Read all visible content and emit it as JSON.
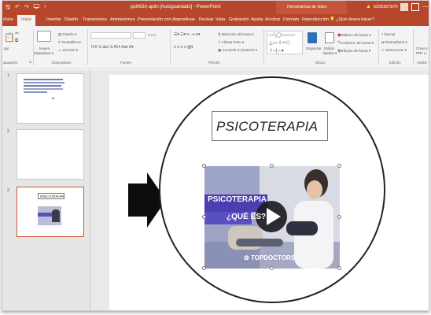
{
  "titlebar": {
    "quick_access": "🖫 ↶ ↷ 🖵 ▾",
    "window_title": "pptNOA aptin [Autoguardado] - PowerPoint",
    "context_label": "Herramientas de vídeo",
    "user": "5256367870",
    "minimize": "—"
  },
  "tabs": [
    {
      "label": "chivo"
    },
    {
      "label": "Inicio",
      "active": true
    },
    {
      "label": "Insertar"
    },
    {
      "label": "Diseño"
    },
    {
      "label": "Transiciones"
    },
    {
      "label": "Animaciones"
    },
    {
      "label": "Presentación con diapositivas"
    },
    {
      "label": "Revisar"
    },
    {
      "label": "Vista"
    },
    {
      "label": "Grabación"
    },
    {
      "label": "Ayuda"
    },
    {
      "label": "Acrobat"
    },
    {
      "label": "Formato"
    },
    {
      "label": "Reproducción"
    },
    {
      "label": "¿Qué desea hacer?"
    }
  ],
  "ribbon": {
    "clipboard": {
      "label": "apapeles",
      "paste": "gar"
    },
    "slides": {
      "label": "Diapositivas",
      "new_slide": "Nueva",
      "new_slide_2": "diapositiva ▾",
      "layout": "Diseño ▾",
      "reset": "Restablecer",
      "section": "Sección ▾"
    },
    "font": {
      "label": "Fuente",
      "row1": "A A A",
      "row2": "N K S abc S AV▾ Aa▾ A▾"
    },
    "paragraph": {
      "label": "Párrafo",
      "direction": "Dirección del texto ▾",
      "align": "Alinear texto ▾",
      "smartart": "Convertir a SmartArt ▾"
    },
    "drawing": {
      "label": "Dibujo",
      "arrange": "Organizar",
      "styles": "Estilos",
      "styles2": "rápidos ▾",
      "fill": "Relleno de forma ▾",
      "outline": "Contorno de forma ▾",
      "effects": "Efectos de forma ▾"
    },
    "editing": {
      "label": "Edición",
      "find": "Buscar",
      "replace": "Reemplazar ▾",
      "select": "Seleccionar ▾"
    },
    "adobe": {
      "label": "Adobe",
      "create": "Crear y",
      "pdf": "PDF a"
    }
  },
  "thumbnails": [
    {
      "number": "1"
    },
    {
      "number": "2"
    },
    {
      "number": "3",
      "title": "PSICOTERAPIA"
    }
  ],
  "slide": {
    "title": "PSICOTERAPIA",
    "video": {
      "headline": "PSICOTERAPIA",
      "subheadline": "¿QUÉ ES?",
      "brand": "TOPDOCTORS"
    }
  },
  "colors": {
    "accent": "#b7472a",
    "tab_active_text": "#b7472a",
    "selected_thumb": "#d2552f",
    "video_banner": "#4a3fae"
  }
}
